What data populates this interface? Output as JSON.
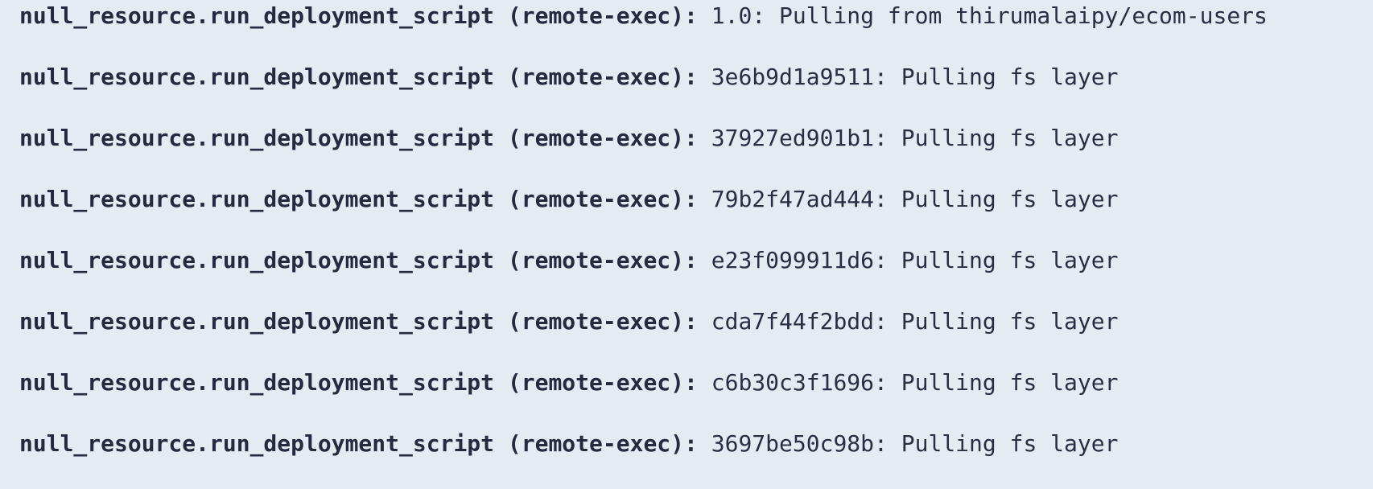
{
  "log": {
    "lines": [
      {
        "resource": "null_resource.run_deployment_script (remote-exec):",
        "message": "1.0: Pulling from thirumalaipy/ecom-users"
      },
      {
        "resource": "null_resource.run_deployment_script (remote-exec):",
        "message": "3e6b9d1a9511: Pulling fs layer"
      },
      {
        "resource": "null_resource.run_deployment_script (remote-exec):",
        "message": "37927ed901b1: Pulling fs layer"
      },
      {
        "resource": "null_resource.run_deployment_script (remote-exec):",
        "message": "79b2f47ad444: Pulling fs layer"
      },
      {
        "resource": "null_resource.run_deployment_script (remote-exec):",
        "message": "e23f099911d6: Pulling fs layer"
      },
      {
        "resource": "null_resource.run_deployment_script (remote-exec):",
        "message": "cda7f44f2bdd: Pulling fs layer"
      },
      {
        "resource": "null_resource.run_deployment_script (remote-exec):",
        "message": "c6b30c3f1696: Pulling fs layer"
      },
      {
        "resource": "null_resource.run_deployment_script (remote-exec):",
        "message": "3697be50c98b: Pulling fs layer"
      }
    ]
  },
  "colors": {
    "background": "#e5ebf3",
    "text": "#262a3f"
  }
}
